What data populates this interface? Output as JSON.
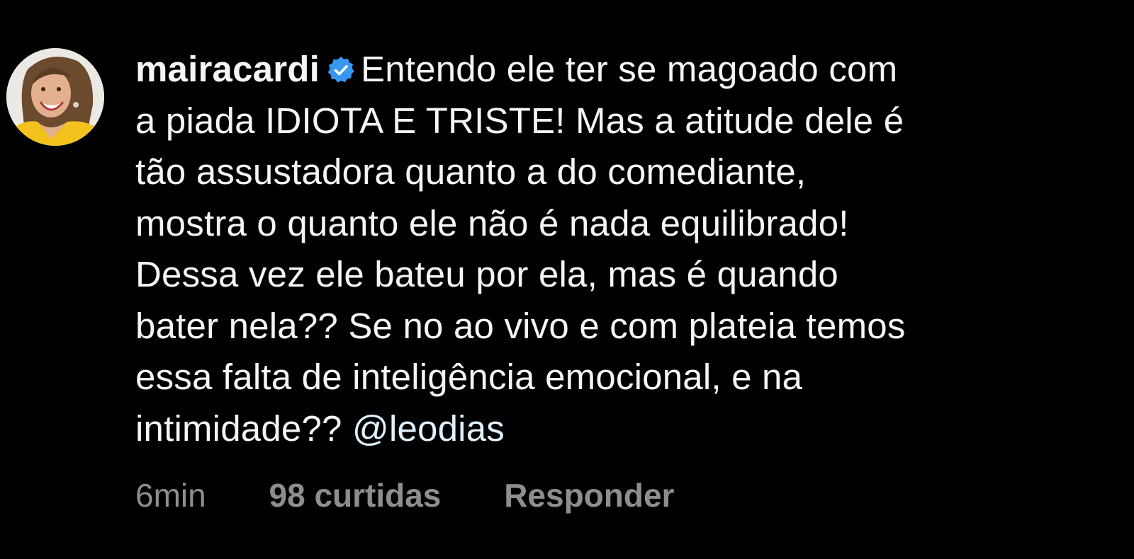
{
  "comment": {
    "username": "mairacardi",
    "verified": true,
    "avatar_icon": "profile-photo",
    "text_lines": [
      "Entendo ele ter se magoado com",
      "a piada IDIOTA E TRISTE! Mas a atitude dele é",
      "tão assustadora quanto a do comediante,",
      "mostra o quanto ele não é nada equilibrado!",
      "Dessa vez ele bateu por ela, mas é quando",
      "bater nela?? Se no ao vivo e com plateia temos",
      "essa falta de inteligência emocional, e na",
      "intimidade??"
    ],
    "mention": "@leodias",
    "time": "6min",
    "likes": "98 curtidas",
    "reply_label": "Responder"
  },
  "colors": {
    "background": "#000000",
    "text": "#f5f5f5",
    "meta": "#8e8e8e",
    "mention": "#e0f1ff",
    "verified_badge": "#3897f0"
  }
}
